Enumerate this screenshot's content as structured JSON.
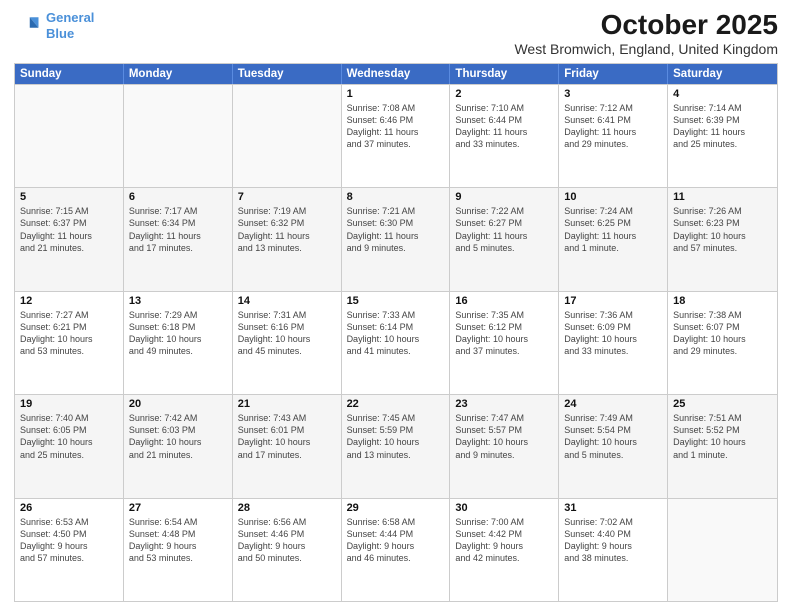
{
  "logo": {
    "line1": "General",
    "line2": "Blue"
  },
  "title": "October 2025",
  "subtitle": "West Bromwich, England, United Kingdom",
  "weekdays": [
    "Sunday",
    "Monday",
    "Tuesday",
    "Wednesday",
    "Thursday",
    "Friday",
    "Saturday"
  ],
  "weeks": [
    [
      {
        "day": "",
        "info": ""
      },
      {
        "day": "",
        "info": ""
      },
      {
        "day": "",
        "info": ""
      },
      {
        "day": "1",
        "info": "Sunrise: 7:08 AM\nSunset: 6:46 PM\nDaylight: 11 hours\nand 37 minutes."
      },
      {
        "day": "2",
        "info": "Sunrise: 7:10 AM\nSunset: 6:44 PM\nDaylight: 11 hours\nand 33 minutes."
      },
      {
        "day": "3",
        "info": "Sunrise: 7:12 AM\nSunset: 6:41 PM\nDaylight: 11 hours\nand 29 minutes."
      },
      {
        "day": "4",
        "info": "Sunrise: 7:14 AM\nSunset: 6:39 PM\nDaylight: 11 hours\nand 25 minutes."
      }
    ],
    [
      {
        "day": "5",
        "info": "Sunrise: 7:15 AM\nSunset: 6:37 PM\nDaylight: 11 hours\nand 21 minutes."
      },
      {
        "day": "6",
        "info": "Sunrise: 7:17 AM\nSunset: 6:34 PM\nDaylight: 11 hours\nand 17 minutes."
      },
      {
        "day": "7",
        "info": "Sunrise: 7:19 AM\nSunset: 6:32 PM\nDaylight: 11 hours\nand 13 minutes."
      },
      {
        "day": "8",
        "info": "Sunrise: 7:21 AM\nSunset: 6:30 PM\nDaylight: 11 hours\nand 9 minutes."
      },
      {
        "day": "9",
        "info": "Sunrise: 7:22 AM\nSunset: 6:27 PM\nDaylight: 11 hours\nand 5 minutes."
      },
      {
        "day": "10",
        "info": "Sunrise: 7:24 AM\nSunset: 6:25 PM\nDaylight: 11 hours\nand 1 minute."
      },
      {
        "day": "11",
        "info": "Sunrise: 7:26 AM\nSunset: 6:23 PM\nDaylight: 10 hours\nand 57 minutes."
      }
    ],
    [
      {
        "day": "12",
        "info": "Sunrise: 7:27 AM\nSunset: 6:21 PM\nDaylight: 10 hours\nand 53 minutes."
      },
      {
        "day": "13",
        "info": "Sunrise: 7:29 AM\nSunset: 6:18 PM\nDaylight: 10 hours\nand 49 minutes."
      },
      {
        "day": "14",
        "info": "Sunrise: 7:31 AM\nSunset: 6:16 PM\nDaylight: 10 hours\nand 45 minutes."
      },
      {
        "day": "15",
        "info": "Sunrise: 7:33 AM\nSunset: 6:14 PM\nDaylight: 10 hours\nand 41 minutes."
      },
      {
        "day": "16",
        "info": "Sunrise: 7:35 AM\nSunset: 6:12 PM\nDaylight: 10 hours\nand 37 minutes."
      },
      {
        "day": "17",
        "info": "Sunrise: 7:36 AM\nSunset: 6:09 PM\nDaylight: 10 hours\nand 33 minutes."
      },
      {
        "day": "18",
        "info": "Sunrise: 7:38 AM\nSunset: 6:07 PM\nDaylight: 10 hours\nand 29 minutes."
      }
    ],
    [
      {
        "day": "19",
        "info": "Sunrise: 7:40 AM\nSunset: 6:05 PM\nDaylight: 10 hours\nand 25 minutes."
      },
      {
        "day": "20",
        "info": "Sunrise: 7:42 AM\nSunset: 6:03 PM\nDaylight: 10 hours\nand 21 minutes."
      },
      {
        "day": "21",
        "info": "Sunrise: 7:43 AM\nSunset: 6:01 PM\nDaylight: 10 hours\nand 17 minutes."
      },
      {
        "day": "22",
        "info": "Sunrise: 7:45 AM\nSunset: 5:59 PM\nDaylight: 10 hours\nand 13 minutes."
      },
      {
        "day": "23",
        "info": "Sunrise: 7:47 AM\nSunset: 5:57 PM\nDaylight: 10 hours\nand 9 minutes."
      },
      {
        "day": "24",
        "info": "Sunrise: 7:49 AM\nSunset: 5:54 PM\nDaylight: 10 hours\nand 5 minutes."
      },
      {
        "day": "25",
        "info": "Sunrise: 7:51 AM\nSunset: 5:52 PM\nDaylight: 10 hours\nand 1 minute."
      }
    ],
    [
      {
        "day": "26",
        "info": "Sunrise: 6:53 AM\nSunset: 4:50 PM\nDaylight: 9 hours\nand 57 minutes."
      },
      {
        "day": "27",
        "info": "Sunrise: 6:54 AM\nSunset: 4:48 PM\nDaylight: 9 hours\nand 53 minutes."
      },
      {
        "day": "28",
        "info": "Sunrise: 6:56 AM\nSunset: 4:46 PM\nDaylight: 9 hours\nand 50 minutes."
      },
      {
        "day": "29",
        "info": "Sunrise: 6:58 AM\nSunset: 4:44 PM\nDaylight: 9 hours\nand 46 minutes."
      },
      {
        "day": "30",
        "info": "Sunrise: 7:00 AM\nSunset: 4:42 PM\nDaylight: 9 hours\nand 42 minutes."
      },
      {
        "day": "31",
        "info": "Sunrise: 7:02 AM\nSunset: 4:40 PM\nDaylight: 9 hours\nand 38 minutes."
      },
      {
        "day": "",
        "info": ""
      }
    ]
  ]
}
